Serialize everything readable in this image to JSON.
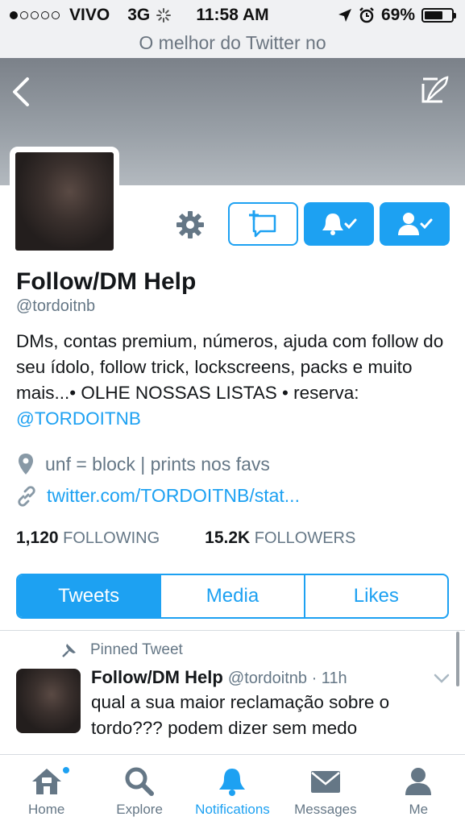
{
  "status_bar": {
    "carrier": "VIVO",
    "network": "3G",
    "time": "11:58 AM",
    "battery": "69%",
    "battery_fraction": 0.69
  },
  "subtitle": "O melhor do Twitter no",
  "profile": {
    "name": "Follow/DM Help",
    "handle": "@tordoitnb",
    "bio_text": "DMs, contas premium, números, ajuda com follow do seu ídolo, follow trick, lockscreens, packs e muito mais...• OLHE NOSSAS LISTAS • reserva: ",
    "bio_link": "@TORDOITNB",
    "location": "unf = block | prints nos favs",
    "url": "twitter.com/TORDOITNB/stat..."
  },
  "stats": {
    "following_count": "1,120",
    "following_label": "FOLLOWING",
    "followers_count": "15.2K",
    "followers_label": "FOLLOWERS"
  },
  "tabs": [
    {
      "label": "Tweets",
      "active": true
    },
    {
      "label": "Media",
      "active": false
    },
    {
      "label": "Likes",
      "active": false
    }
  ],
  "pinned_tweet": {
    "pinned_label": "Pinned Tweet",
    "author_name": "Follow/DM Help",
    "author_meta": "@tordoitnb · 11h",
    "text": "qual a sua maior reclamação sobre o tordo??? podem dizer sem medo"
  },
  "bottom_nav": [
    {
      "label": "Home",
      "icon": "home-icon"
    },
    {
      "label": "Explore",
      "icon": "search-icon"
    },
    {
      "label": "Notifications",
      "icon": "bell-icon"
    },
    {
      "label": "Messages",
      "icon": "envelope-icon"
    },
    {
      "label": "Me",
      "icon": "person-icon"
    }
  ],
  "colors": {
    "accent": "#1da1f2",
    "secondary_text": "#657786"
  }
}
